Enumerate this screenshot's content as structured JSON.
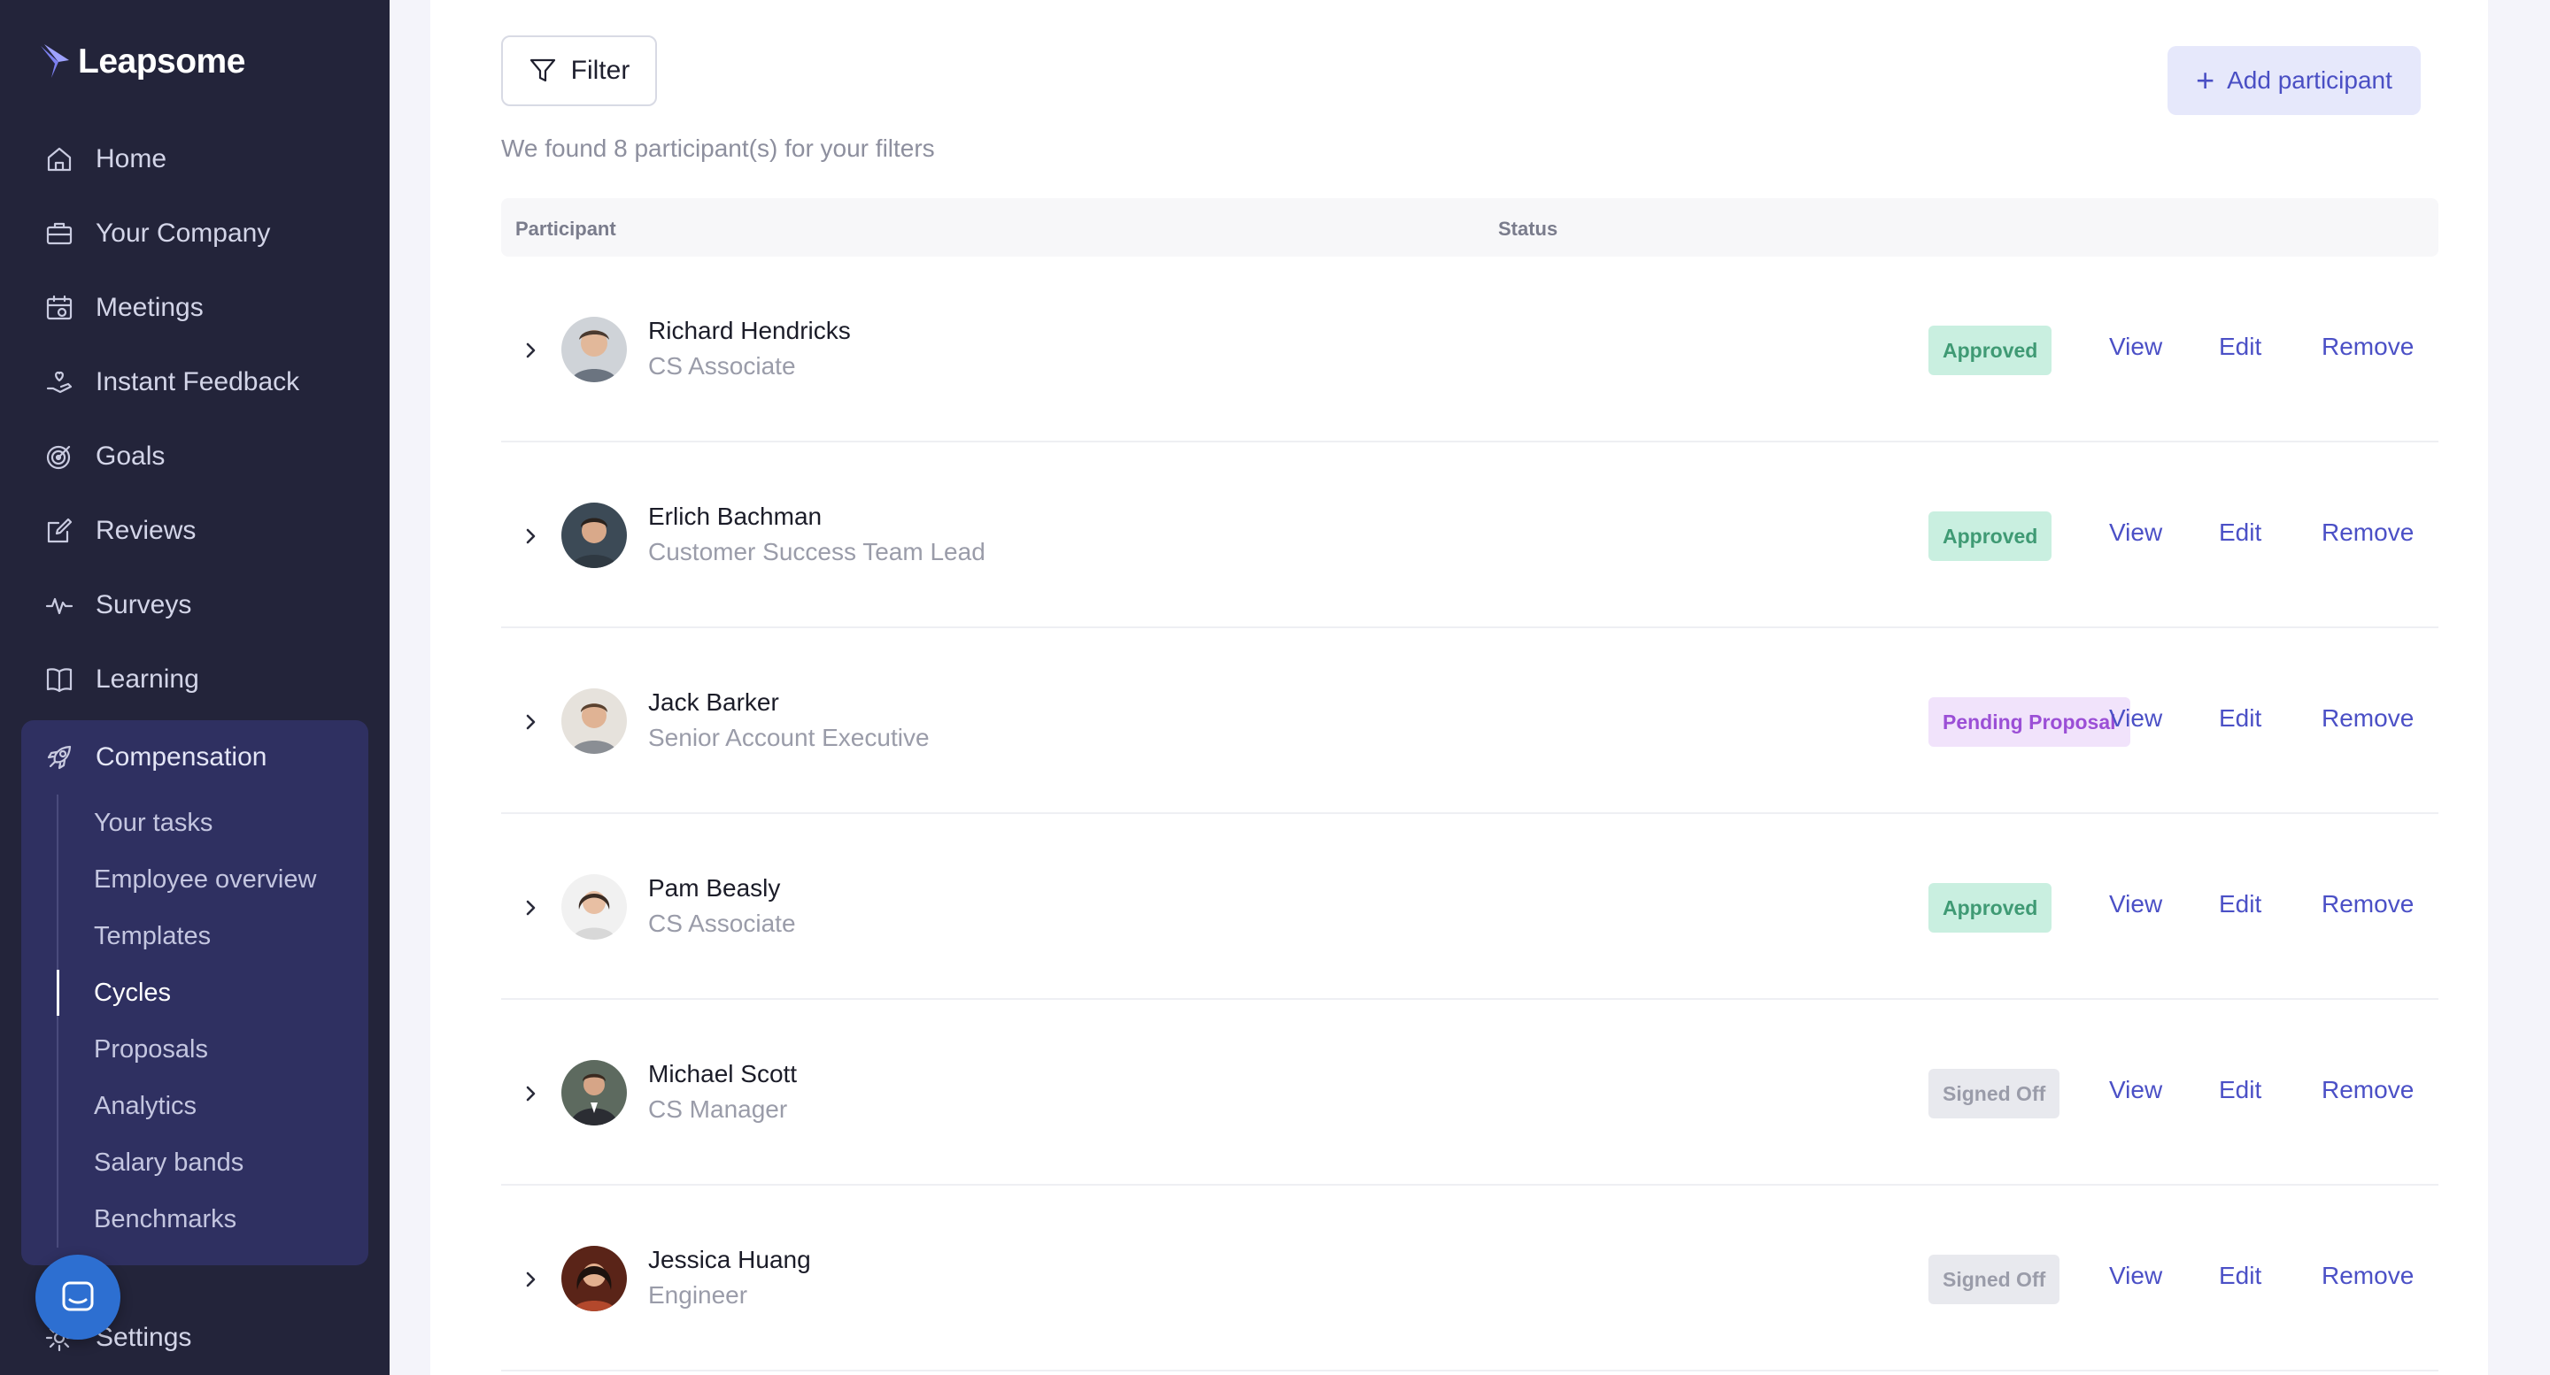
{
  "brand": {
    "name": "Leapsome"
  },
  "sidebar": {
    "items": [
      {
        "label": "Home",
        "icon": "home-icon"
      },
      {
        "label": "Your Company",
        "icon": "briefcase-icon"
      },
      {
        "label": "Meetings",
        "icon": "calendar-icon"
      },
      {
        "label": "Instant Feedback",
        "icon": "hand-heart-icon"
      },
      {
        "label": "Goals",
        "icon": "target-icon"
      },
      {
        "label": "Reviews",
        "icon": "edit-icon"
      },
      {
        "label": "Surveys",
        "icon": "pulse-icon"
      },
      {
        "label": "Learning",
        "icon": "book-icon"
      }
    ],
    "compensation": {
      "label": "Compensation",
      "icon": "rocket-icon",
      "subitems": [
        {
          "label": "Your tasks"
        },
        {
          "label": "Employee overview"
        },
        {
          "label": "Templates"
        },
        {
          "label": "Cycles"
        },
        {
          "label": "Proposals"
        },
        {
          "label": "Analytics"
        },
        {
          "label": "Salary bands"
        },
        {
          "label": "Benchmarks"
        }
      ],
      "active": "Cycles"
    },
    "settings": {
      "label": "Settings",
      "icon": "gear-icon"
    }
  },
  "toolbar": {
    "filter_label": "Filter",
    "add_label": "Add participant",
    "found_text": "We found 8 participant(s) for your filters"
  },
  "table": {
    "headers": {
      "participant": "Participant",
      "status": "Status"
    },
    "actions": {
      "view": "View",
      "edit": "Edit",
      "remove": "Remove"
    },
    "rows": [
      {
        "name": "Richard Hendricks",
        "role": "CS Associate",
        "status": "Approved",
        "status_kind": "approved"
      },
      {
        "name": "Erlich Bachman",
        "role": "Customer Success Team Lead",
        "status": "Approved",
        "status_kind": "approved"
      },
      {
        "name": "Jack Barker",
        "role": "Senior Account Executive",
        "status": "Pending Proposal",
        "status_kind": "pending"
      },
      {
        "name": "Pam Beasly",
        "role": "CS Associate",
        "status": "Approved",
        "status_kind": "approved"
      },
      {
        "name": "Michael Scott",
        "role": "CS Manager",
        "status": "Signed Off",
        "status_kind": "signed"
      },
      {
        "name": "Jessica Huang",
        "role": "Engineer",
        "status": "Signed Off",
        "status_kind": "signed"
      }
    ]
  },
  "colors": {
    "sidebar_bg": "#23243a",
    "active_group_bg": "#2f3061",
    "accent": "#4b50c6",
    "approved_bg": "#c9efe0",
    "approved_text": "#3f9a74",
    "pending_bg": "#f1e3fb",
    "pending_text": "#9b4fd6",
    "signed_bg": "#e8e9ee",
    "signed_text": "#9a9ca9"
  }
}
